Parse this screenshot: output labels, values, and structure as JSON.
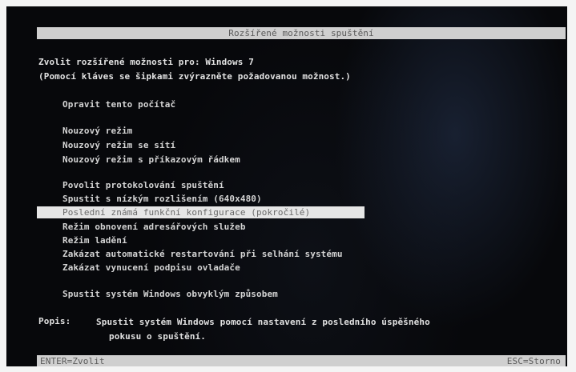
{
  "title": "Rozšířené možnosti spuštění",
  "intro": {
    "line1_prefix": "Zvolit rozšířené možnosti pro:",
    "line1_os": "Windows 7",
    "line2": "(Pomocí kláves se šipkami zvýrazněte požadovanou možnost.)"
  },
  "options": [
    {
      "label": "Opravit tento počítač",
      "selected": false
    },
    {
      "label": "Nouzový režim",
      "selected": false
    },
    {
      "label": "Nouzový režim se sítí",
      "selected": false
    },
    {
      "label": "Nouzový režim s příkazovým řádkem",
      "selected": false
    },
    {
      "label": "Povolit protokolování spuštění",
      "selected": false
    },
    {
      "label": "Spustit s nízkým rozlišením (640x480)",
      "selected": false
    },
    {
      "label": "Poslední známá funkční konfigurace (pokročilé)",
      "selected": true
    },
    {
      "label": "Režim obnovení adresářových služeb",
      "selected": false
    },
    {
      "label": "Režim ladění",
      "selected": false
    },
    {
      "label": "Zakázat automatické restartování při selhání systému",
      "selected": false
    },
    {
      "label": "Zakázat vynucení podpisu ovladače",
      "selected": false
    },
    {
      "label": "Spustit systém Windows obvyklým způsobem",
      "selected": false
    }
  ],
  "description": {
    "label": "Popis:",
    "line1": "Spustit systém Windows pomocí nastavení z posledního úspěšného",
    "line2": "pokusu o spuštění."
  },
  "footer": {
    "left": "ENTER=Zvolit",
    "right": "ESC=Storno"
  },
  "colors": {
    "background": "#07080b",
    "bar": "#cfcfcf",
    "selected_bg": "#e6e6e6",
    "text": "#d8d8d8"
  }
}
